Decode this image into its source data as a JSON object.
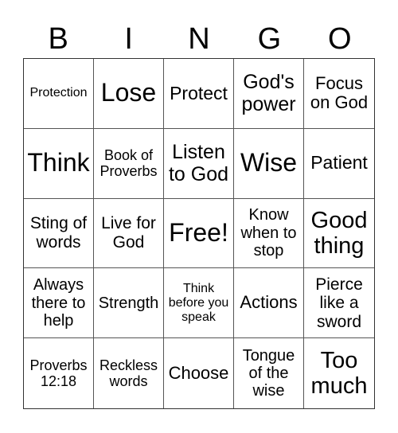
{
  "header": [
    "B",
    "I",
    "N",
    "G",
    "O"
  ],
  "cells": [
    {
      "text": "Protection",
      "size": 16
    },
    {
      "text": "Lose",
      "size": 32
    },
    {
      "text": "Protect",
      "size": 23
    },
    {
      "text": "God's power",
      "size": 25
    },
    {
      "text": "Focus on God",
      "size": 22
    },
    {
      "text": "Think",
      "size": 32
    },
    {
      "text": "Book of Proverbs",
      "size": 18
    },
    {
      "text": "Listen to God",
      "size": 25
    },
    {
      "text": "Wise",
      "size": 32
    },
    {
      "text": "Patient",
      "size": 23
    },
    {
      "text": "Sting of words",
      "size": 21
    },
    {
      "text": "Live for God",
      "size": 21
    },
    {
      "text": "Free!",
      "size": 32
    },
    {
      "text": "Know when to stop",
      "size": 20
    },
    {
      "text": "Good thing",
      "size": 29
    },
    {
      "text": "Always there to help",
      "size": 20
    },
    {
      "text": "Strength",
      "size": 20
    },
    {
      "text": "Think before you speak",
      "size": 16
    },
    {
      "text": "Actions",
      "size": 22
    },
    {
      "text": "Pierce like a sword",
      "size": 21
    },
    {
      "text": "Proverbs 12:18",
      "size": 18
    },
    {
      "text": "Reckless words",
      "size": 18
    },
    {
      "text": "Choose",
      "size": 22
    },
    {
      "text": "Tongue of the wise",
      "size": 20
    },
    {
      "text": "Too much",
      "size": 29
    }
  ]
}
